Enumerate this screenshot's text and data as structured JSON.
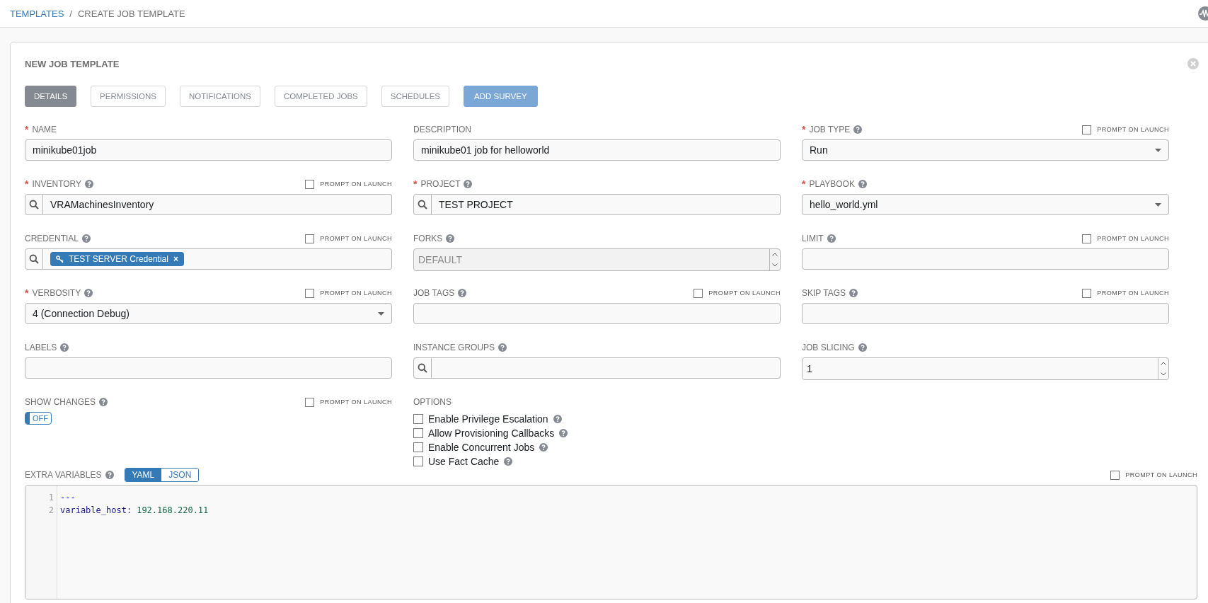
{
  "breadcrumb": {
    "items": [
      {
        "label": "TEMPLATES",
        "link": true
      },
      {
        "label": "CREATE JOB TEMPLATE",
        "link": false
      }
    ],
    "separator": "/"
  },
  "card": {
    "title": "NEW JOB TEMPLATE",
    "tabs": [
      {
        "label": "DETAILS",
        "selected": true
      },
      {
        "label": "PERMISSIONS",
        "selected": false
      },
      {
        "label": "NOTIFICATIONS",
        "selected": false
      },
      {
        "label": "COMPLETED JOBS",
        "selected": false
      },
      {
        "label": "SCHEDULES",
        "selected": false
      }
    ],
    "action_button": "ADD SURVEY",
    "fields": [
      {
        "label": "NAME",
        "required_mark": "*",
        "kind": "text",
        "value": "minikube01job"
      },
      {
        "label": "DESCRIPTION",
        "kind": "text",
        "value": "minikube01 job for helloworld"
      },
      {
        "label": "JOB TYPE",
        "required_mark": "*",
        "help": true,
        "prompt": {
          "label": "PROMPT ON LAUNCH",
          "checked": false
        },
        "kind": "select",
        "value": "Run"
      },
      {
        "label": "INVENTORY",
        "required_mark": "*",
        "help": true,
        "prompt": {
          "label": "PROMPT ON LAUNCH",
          "checked": false
        },
        "kind": "lookup",
        "value": "VRAMachinesInventory"
      },
      {
        "label": "PROJECT",
        "required_mark": "*",
        "help": true,
        "kind": "lookup",
        "value": "TEST PROJECT"
      },
      {
        "label": "PLAYBOOK",
        "required_mark": "*",
        "help": true,
        "kind": "select",
        "value": "hello_world.yml"
      },
      {
        "label": "CREDENTIAL",
        "help": true,
        "prompt": {
          "label": "PROMPT ON LAUNCH",
          "checked": false
        },
        "kind": "lookup",
        "tags": [
          {
            "label": "TEST SERVER Credential",
            "remove": "×"
          }
        ]
      },
      {
        "label": "FORKS",
        "help": true,
        "kind": "number",
        "placeholder": "DEFAULT",
        "disabled": true
      },
      {
        "label": "LIMIT",
        "help": true,
        "prompt": {
          "label": "PROMPT ON LAUNCH",
          "checked": false
        },
        "kind": "text"
      },
      {
        "label": "VERBOSITY",
        "required_mark": "*",
        "help": true,
        "prompt": {
          "label": "PROMPT ON LAUNCH",
          "checked": false
        },
        "kind": "select",
        "value": "4 (Connection Debug)"
      },
      {
        "label": "JOB TAGS",
        "help": true,
        "prompt": {
          "label": "PROMPT ON LAUNCH",
          "checked": false
        },
        "kind": "text"
      },
      {
        "label": "SKIP TAGS",
        "help": true,
        "prompt": {
          "label": "PROMPT ON LAUNCH",
          "checked": false
        },
        "kind": "text"
      },
      {
        "label": "LABELS",
        "help": true,
        "kind": "text"
      },
      {
        "label": "INSTANCE GROUPS",
        "help": true,
        "kind": "lookup"
      },
      {
        "label": "JOB SLICING",
        "help": true,
        "kind": "number",
        "value": "1",
        "disabled": false
      },
      {
        "label": "SHOW CHANGES",
        "help": true,
        "prompt": {
          "label": "PROMPT ON LAUNCH",
          "checked": false
        },
        "kind": "toggle",
        "toggle": {
          "label": "OFF",
          "on": false
        }
      },
      {
        "label": "OPTIONS",
        "kind": "options",
        "options": [
          {
            "label": "Enable Privilege Escalation",
            "checked": false
          },
          {
            "label": "Allow Provisioning Callbacks",
            "checked": false
          },
          {
            "label": "Enable Concurrent Jobs",
            "checked": false
          },
          {
            "label": "Use Fact Cache",
            "checked": false
          }
        ]
      }
    ],
    "extra_variables": {
      "label": "EXTRA VARIABLES",
      "help": true,
      "formats": [
        {
          "label": "YAML",
          "selected": true
        },
        {
          "label": "JSON",
          "selected": false
        }
      ],
      "prompt": {
        "label": "PROMPT ON LAUNCH",
        "checked": false
      },
      "lines": [
        {
          "number": "1",
          "parts": [
            {
              "text": "---",
              "kind": "meta"
            }
          ]
        },
        {
          "number": "2",
          "parts": [
            {
              "text": "variable_host",
              "kind": "key"
            },
            {
              "text": ":",
              "kind": "punct"
            },
            {
              "text": "192.168.220.11",
              "kind": "value"
            }
          ]
        }
      ]
    }
  }
}
